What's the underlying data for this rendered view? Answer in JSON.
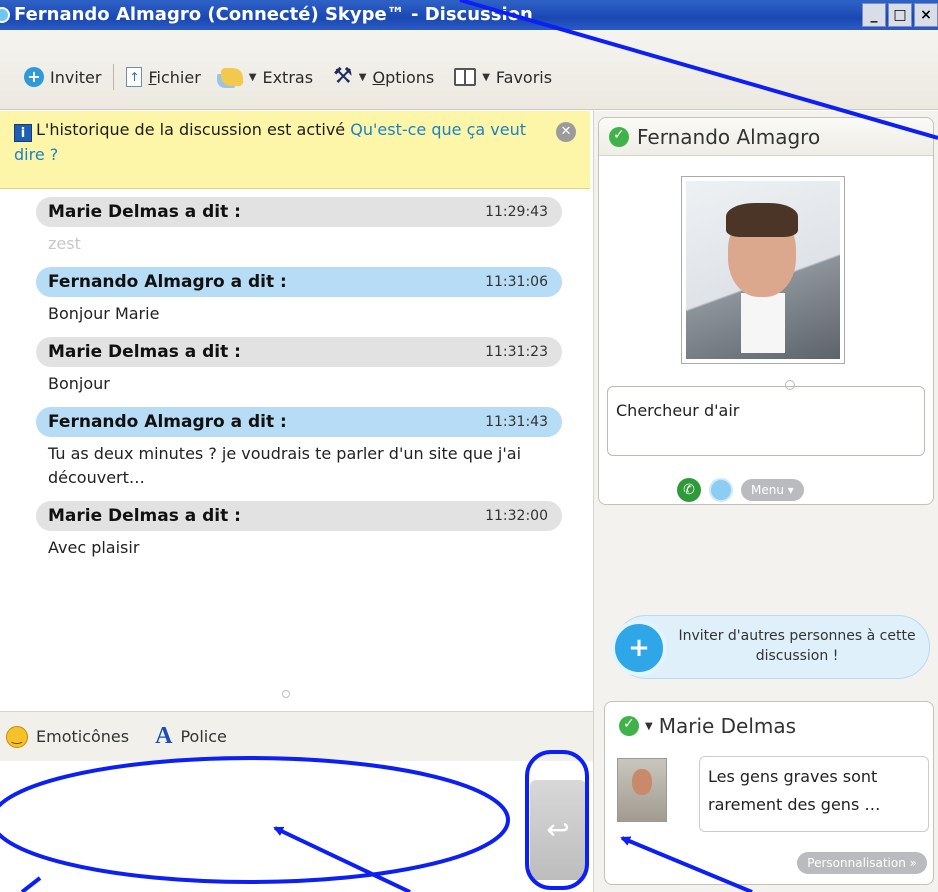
{
  "window": {
    "title": "Fernando Almagro (Connecté) Skype™ - Discussion",
    "controls": [
      "_",
      "□",
      "×"
    ]
  },
  "toolbar": {
    "invite": "Inviter",
    "file": "Fichier",
    "extras": "Extras",
    "options": "Options",
    "favorites": "Favoris"
  },
  "notice": {
    "text": "L'historique de la discussion est activé",
    "link": "Qu'est-ce que ça veut dire ?"
  },
  "messages": [
    {
      "author": "Marie Delmas a dit :",
      "time": "11:29:43",
      "text": "zest",
      "self": false
    },
    {
      "author": "Fernando Almagro a dit :",
      "time": "11:31:06",
      "text": "Bonjour Marie",
      "self": true
    },
    {
      "author": "Marie Delmas a dit :",
      "time": "11:31:23",
      "text": "Bonjour",
      "self": false
    },
    {
      "author": "Fernando Almagro a dit :",
      "time": "11:31:43",
      "text": "Tu as deux minutes ? je voudrais te parler d'un site que j'ai découvert…",
      "self": true
    },
    {
      "author": "Marie Delmas a dit :",
      "time": "11:32:00",
      "text": "Avec plaisir",
      "self": false
    }
  ],
  "compose": {
    "emoticons": "Emoticônes",
    "font": "Police",
    "send_icon": "↩"
  },
  "contact": {
    "name": "Fernando Almagro",
    "mood": "Chercheur d'air",
    "menu_label": "Menu"
  },
  "invite_others": {
    "text": "Inviter d'autres personnes à cette discussion !"
  },
  "me": {
    "name": "Marie Delmas",
    "mood": "Les gens graves sont rarement des gens …",
    "personalize": "Personnalisation »"
  },
  "colors": {
    "title_bar": "#1a48b3",
    "notice_bg": "#fdf6a8",
    "self_bubble": "#b7dcf6",
    "other_bubble": "#e2e2e2",
    "annotation": "#0c1ff5",
    "skype_green": "#3fb249"
  }
}
